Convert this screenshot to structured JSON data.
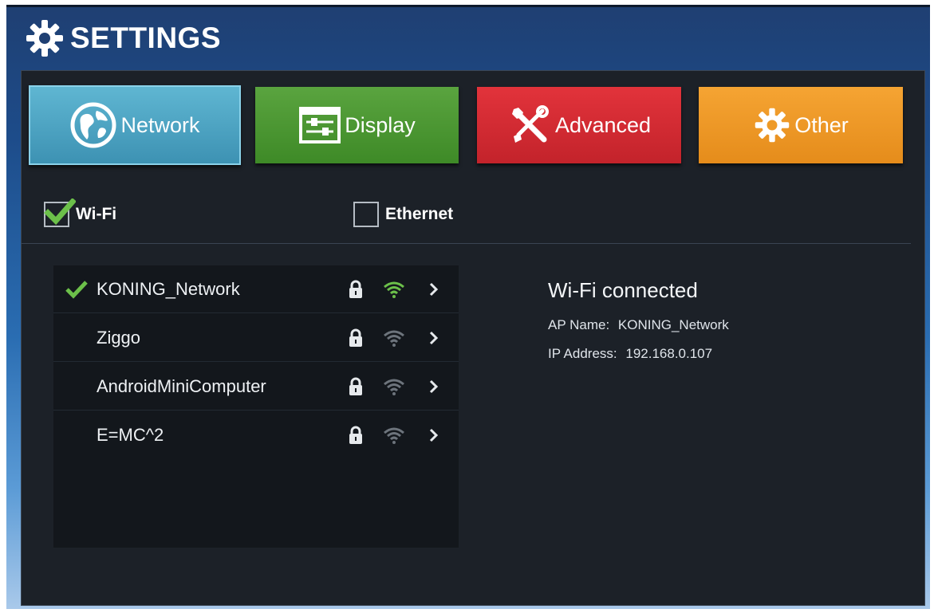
{
  "header": {
    "title": "SETTINGS",
    "icon": "gear-icon"
  },
  "tabs": [
    {
      "label": "Network",
      "icon": "globe-icon",
      "color": "#4ba6c5",
      "selected": true
    },
    {
      "label": "Display",
      "icon": "display-sliders-icon",
      "color": "#4c9a33",
      "selected": false
    },
    {
      "label": "Advanced",
      "icon": "tools-icon",
      "color": "#d42a32",
      "selected": false
    },
    {
      "label": "Other",
      "icon": "gear-icon",
      "color": "#ee9a27",
      "selected": false
    }
  ],
  "connections": {
    "wifi": {
      "label": "Wi-Fi",
      "checked": true,
      "check_color": "#6cc04a"
    },
    "ethernet": {
      "label": "Ethernet",
      "checked": false
    }
  },
  "networks": [
    {
      "name": "KONING_Network",
      "connected": true,
      "secured": true,
      "signal_active": true
    },
    {
      "name": "Ziggo",
      "connected": false,
      "secured": true,
      "signal_active": false
    },
    {
      "name": "AndroidMiniComputer",
      "connected": false,
      "secured": true,
      "signal_active": false
    },
    {
      "name": "E=MC^2",
      "connected": false,
      "secured": true,
      "signal_active": false
    }
  ],
  "status": {
    "title": "Wi-Fi connected",
    "ap_label": "AP Name:",
    "ap_value": "KONING_Network",
    "ip_label": "IP Address:",
    "ip_value": "192.168.0.107"
  },
  "colors": {
    "accent_green": "#6cc04a",
    "panel_bg": "#1c2128"
  }
}
